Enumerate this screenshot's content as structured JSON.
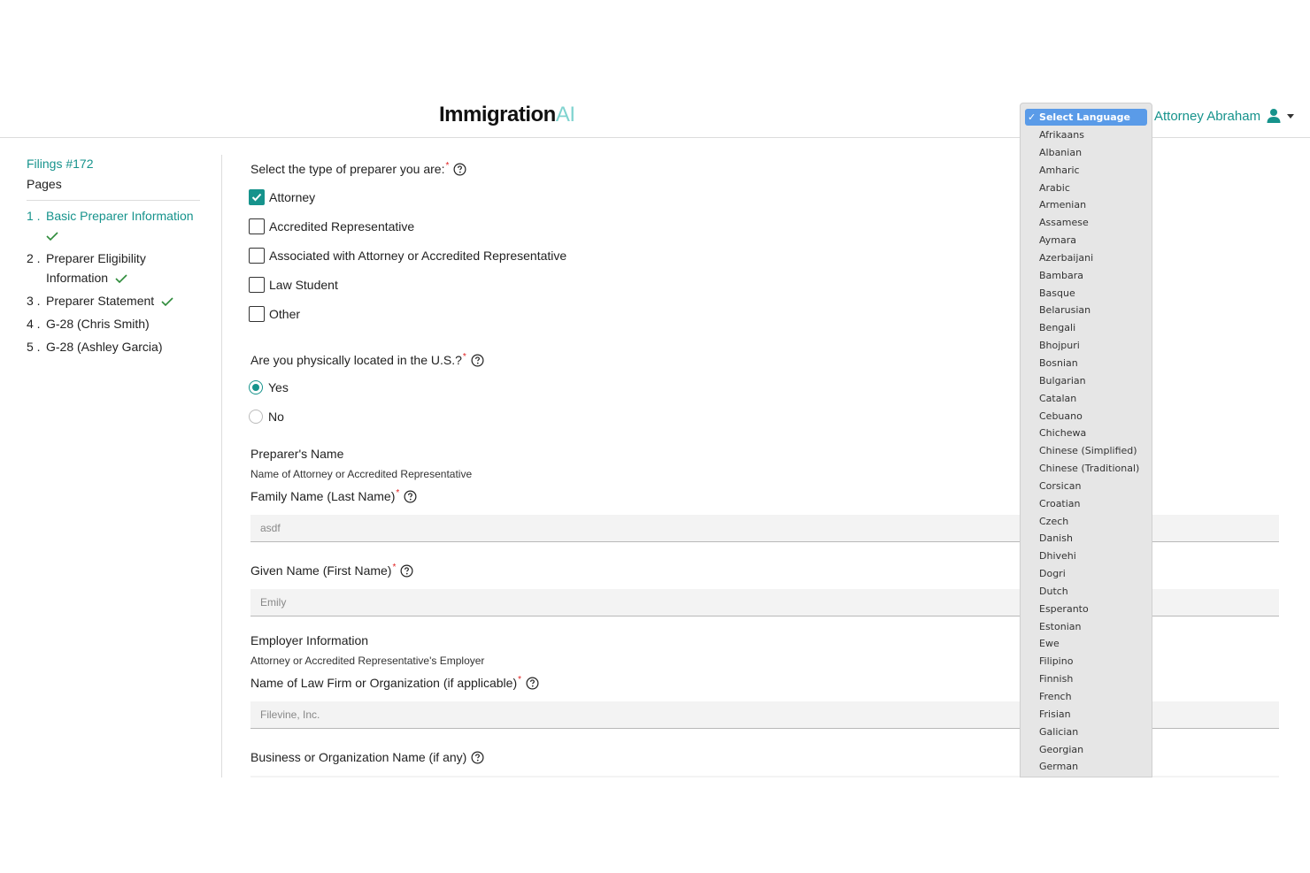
{
  "header": {
    "logo_main": "Immigration",
    "logo_accent": "AI",
    "user_name": "Attorney Abraham",
    "accent_color": "#16938c"
  },
  "sidebar": {
    "filing_link": "Filings #172",
    "pages_title": "Pages",
    "items": [
      {
        "num": "1 .",
        "label": "Basic Preparer Information",
        "complete": true,
        "active": true
      },
      {
        "num": "2 .",
        "label": "Preparer Eligibility Information",
        "complete": true,
        "active": false
      },
      {
        "num": "3 .",
        "label": "Preparer Statement",
        "complete": true,
        "active": false
      },
      {
        "num": "4 .",
        "label": "G-28 (Chris Smith)",
        "complete": false,
        "active": false
      },
      {
        "num": "5 .",
        "label": "G-28 (Ashley Garcia)",
        "complete": false,
        "active": false
      }
    ]
  },
  "form": {
    "preparer_type": {
      "label": "Select the type of preparer you are:",
      "options": [
        {
          "label": "Attorney",
          "checked": true
        },
        {
          "label": "Accredited Representative",
          "checked": false
        },
        {
          "label": "Associated with Attorney or Accredited Representative",
          "checked": false
        },
        {
          "label": "Law Student",
          "checked": false
        },
        {
          "label": "Other",
          "checked": false
        }
      ]
    },
    "location": {
      "label": "Are you physically located in the U.S.?",
      "options": [
        {
          "label": "Yes",
          "checked": true
        },
        {
          "label": "No",
          "checked": false
        }
      ]
    },
    "preparer_name": {
      "title": "Preparer's Name",
      "subtitle": "Name of Attorney or Accredited Representative",
      "family_label": "Family Name (Last Name)",
      "family_value": "asdf",
      "given_label": "Given Name (First Name)",
      "given_value": "Emily"
    },
    "employer": {
      "title": "Employer Information",
      "subtitle": "Attorney or Accredited Representative's Employer",
      "firm_label": "Name of Law Firm or Organization (if applicable)",
      "firm_value": "Filevine, Inc.",
      "business_label": "Business or Organization Name (if any)"
    }
  },
  "language_dropdown": {
    "selected": "✓ Select Language",
    "options": [
      "Afrikaans",
      "Albanian",
      "Amharic",
      "Arabic",
      "Armenian",
      "Assamese",
      "Aymara",
      "Azerbaijani",
      "Bambara",
      "Basque",
      "Belarusian",
      "Bengali",
      "Bhojpuri",
      "Bosnian",
      "Bulgarian",
      "Catalan",
      "Cebuano",
      "Chichewa",
      "Chinese (Simplified)",
      "Chinese (Traditional)",
      "Corsican",
      "Croatian",
      "Czech",
      "Danish",
      "Dhivehi",
      "Dogri",
      "Dutch",
      "Esperanto",
      "Estonian",
      "Ewe",
      "Filipino",
      "Finnish",
      "French",
      "Frisian",
      "Galician",
      "Georgian",
      "German"
    ]
  }
}
